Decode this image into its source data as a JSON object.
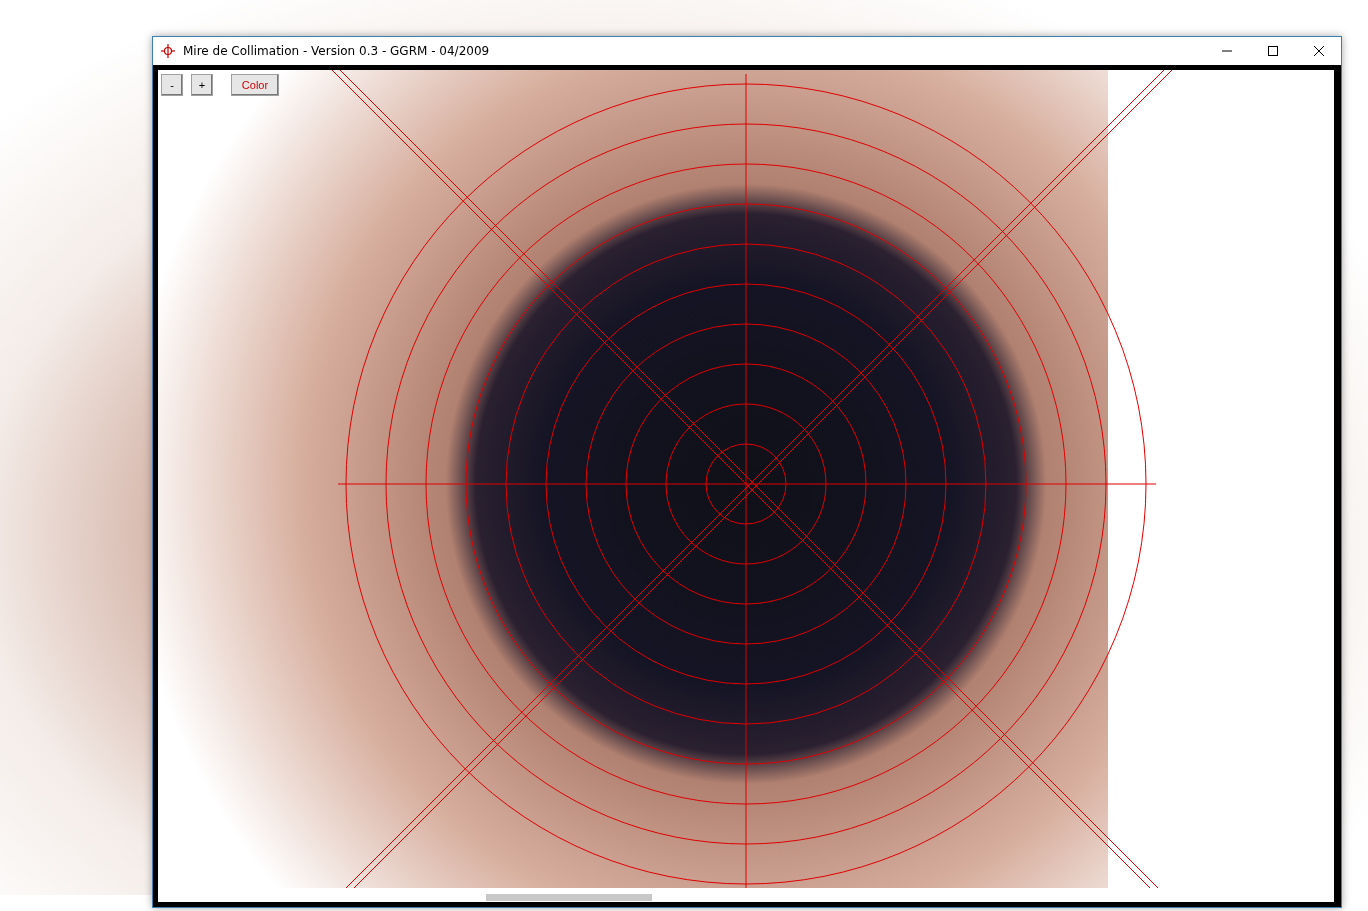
{
  "window": {
    "title": "Mire de Collimation - Version 0.3 - GGRM - 04/2009"
  },
  "toolbar": [
    {
      "label": "-",
      "kind": "zoom"
    },
    {
      "label": "+",
      "kind": "zoom"
    },
    {
      "label": "Color",
      "kind": "color"
    }
  ]
}
